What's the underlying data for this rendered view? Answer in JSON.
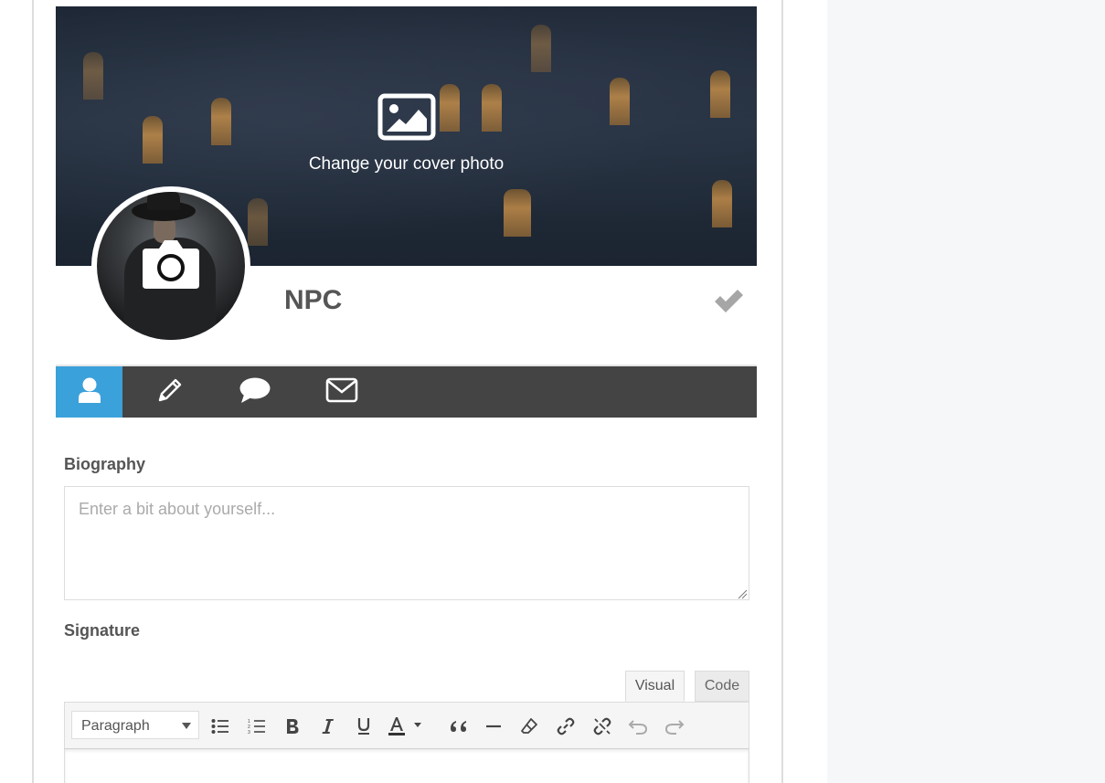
{
  "cover": {
    "change_text": "Change your cover photo",
    "icon": "image-icon"
  },
  "avatar": {
    "icon": "camera-icon"
  },
  "profile": {
    "name": "NPC",
    "save_icon": "checkmark-icon"
  },
  "tabs": [
    {
      "name": "profile",
      "icon": "user-icon",
      "active": true
    },
    {
      "name": "posts",
      "icon": "pencil-icon",
      "active": false
    },
    {
      "name": "comments",
      "icon": "speech-bubble-icon",
      "active": false
    },
    {
      "name": "messages",
      "icon": "envelope-icon",
      "active": false
    }
  ],
  "biography": {
    "label": "Biography",
    "placeholder": "Enter a bit about yourself..."
  },
  "signature": {
    "label": "Signature",
    "tab_visual": "Visual",
    "tab_code": "Code",
    "format_value": "Paragraph",
    "toolbar": [
      "bulleted-list-icon",
      "numbered-list-icon",
      "bold-icon",
      "italic-icon",
      "underline-icon",
      "text-color-icon",
      "blockquote-icon",
      "horizontal-rule-icon",
      "clear-formatting-icon",
      "link-icon",
      "unlink-icon",
      "undo-icon",
      "redo-icon"
    ]
  },
  "colors": {
    "accent": "#3ba1da",
    "tabbar": "#444444",
    "text": "#555555"
  }
}
